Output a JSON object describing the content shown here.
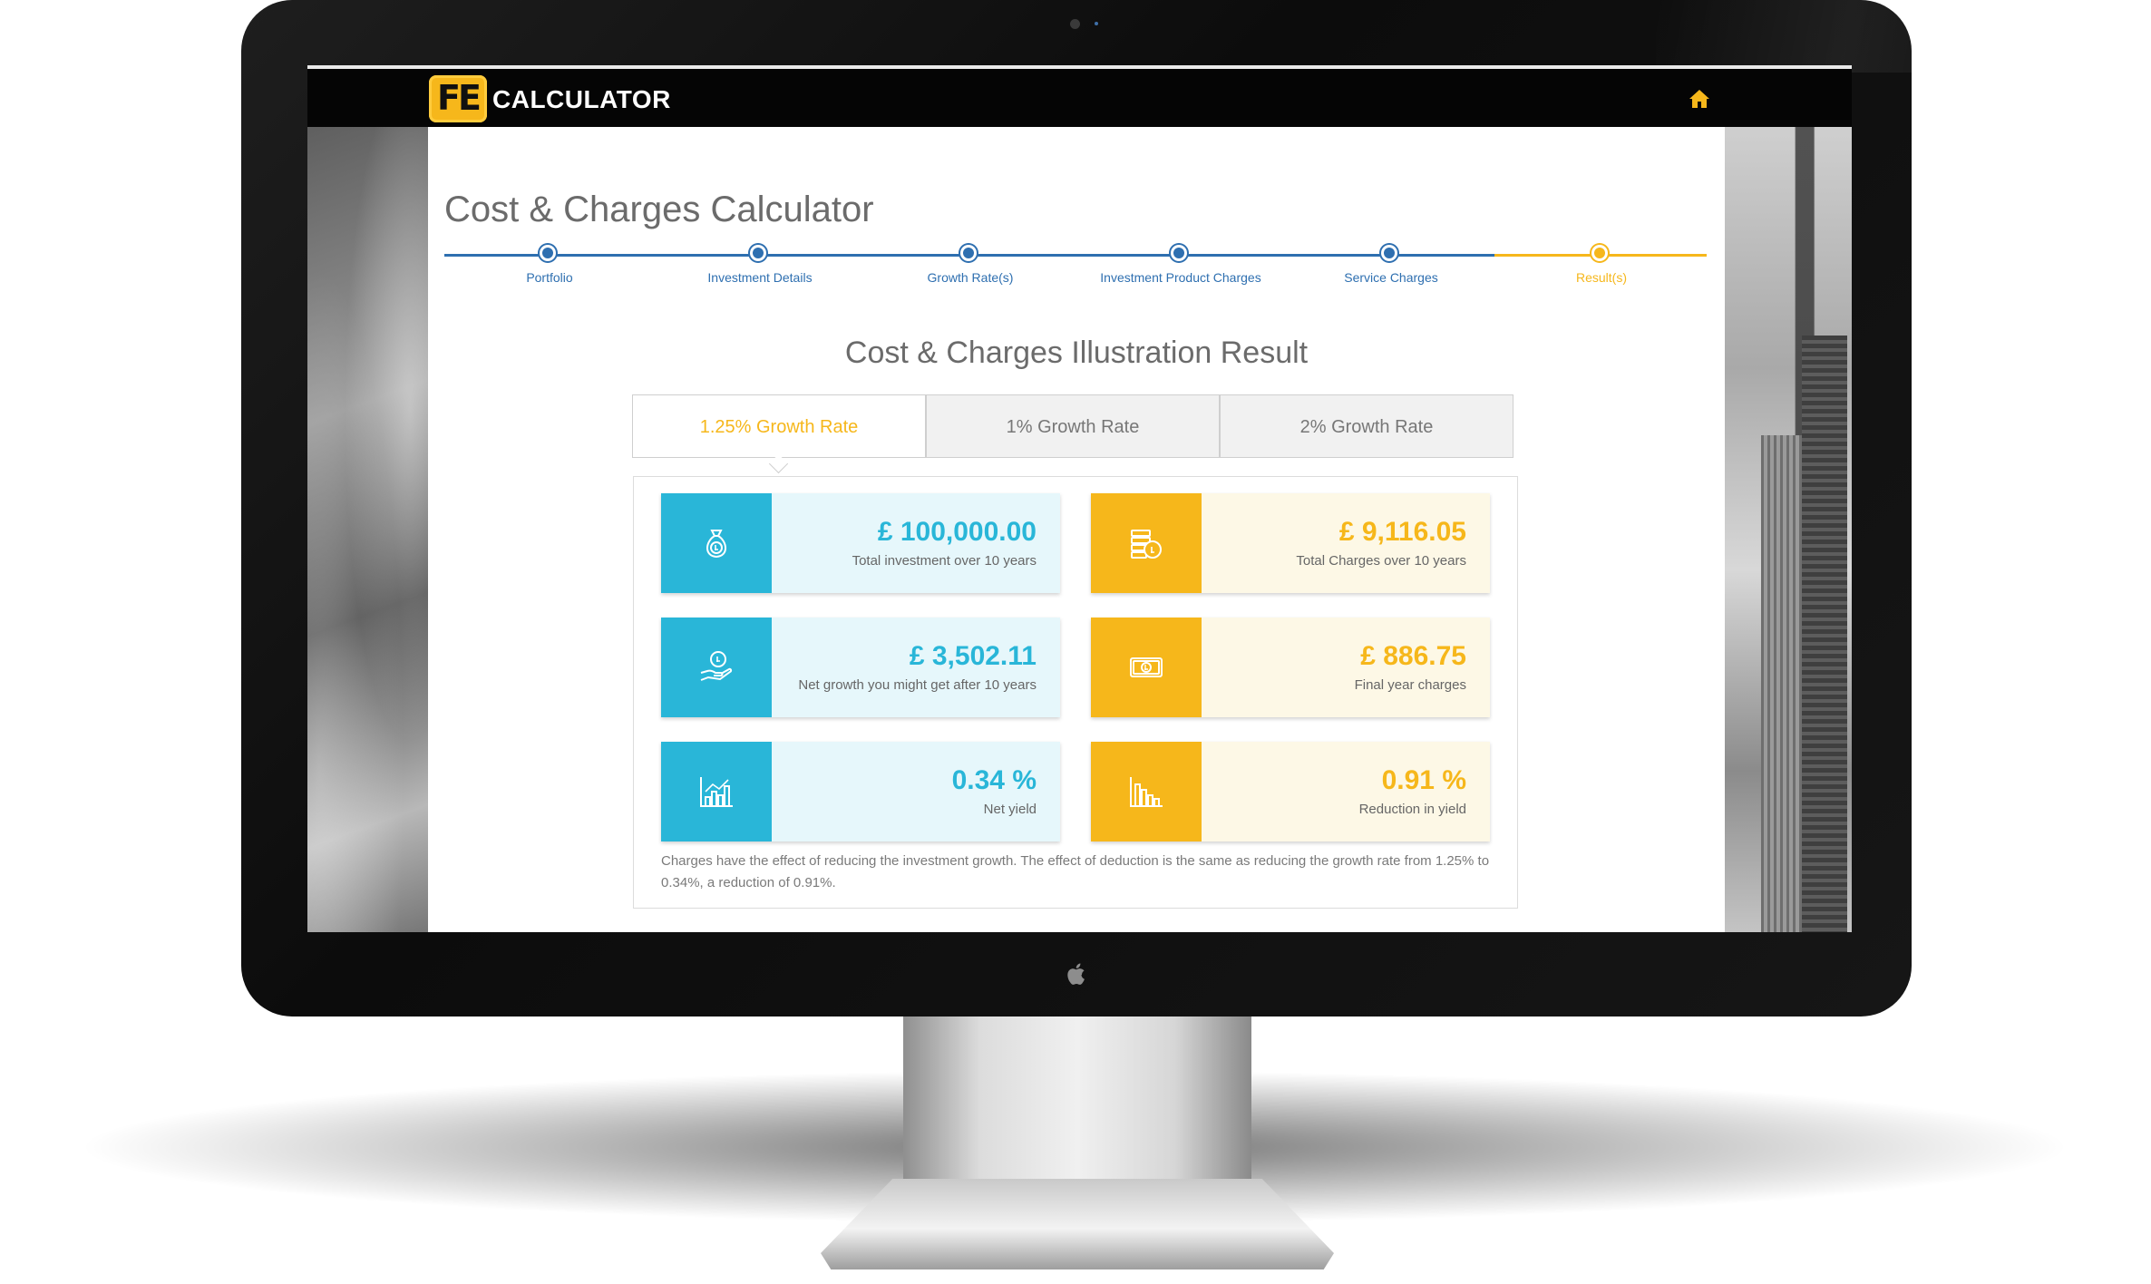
{
  "app": {
    "logo_mark": "FE",
    "logo_text": "CALCULATOR",
    "home_icon": "home-icon"
  },
  "page": {
    "title": "Cost & Charges Calculator",
    "section_title": "Cost & Charges Illustration Result"
  },
  "stepper": {
    "steps": [
      {
        "label": "Portfolio",
        "state": "complete"
      },
      {
        "label": "Investment Details",
        "state": "complete"
      },
      {
        "label": "Growth Rate(s)",
        "state": "complete"
      },
      {
        "label": "Investment Product Charges",
        "state": "complete"
      },
      {
        "label": "Service Charges",
        "state": "complete"
      },
      {
        "label": "Result(s)",
        "state": "active"
      }
    ]
  },
  "tabs": [
    {
      "label": "1.25% Growth Rate",
      "active": true
    },
    {
      "label": "1% Growth Rate",
      "active": false
    },
    {
      "label": "2% Growth Rate",
      "active": false
    }
  ],
  "results": {
    "total_investment": {
      "value": "£ 100,000.00",
      "caption": "Total investment over 10 years",
      "icon": "money-bag-icon"
    },
    "total_charges": {
      "value": "£ 9,116.05",
      "caption": "Total Charges over 10 years",
      "icon": "coins-icon"
    },
    "net_growth": {
      "value": "£ 3,502.11",
      "caption": "Net growth you might get after 10 years",
      "icon": "hand-coin-icon"
    },
    "final_year_charges": {
      "value": "£ 886.75",
      "caption": "Final year charges",
      "icon": "banknote-icon"
    },
    "net_yield": {
      "value": "0.34 %",
      "caption": "Net yield",
      "icon": "bar-chart-up-icon"
    },
    "reduction_in_yield": {
      "value": "0.91 %",
      "caption": "Reduction in yield",
      "icon": "bar-chart-down-icon"
    }
  },
  "note": "Charges have the effect of reducing the investment growth. The effect of deduction is the same as reducing the growth rate from 1.25% to 0.34%, a reduction of 0.91%.",
  "colors": {
    "accent_blue": "#29b6d8",
    "accent_yellow": "#f6b71b",
    "stepper_blue": "#2e6fb0",
    "topbar": "#050505"
  }
}
